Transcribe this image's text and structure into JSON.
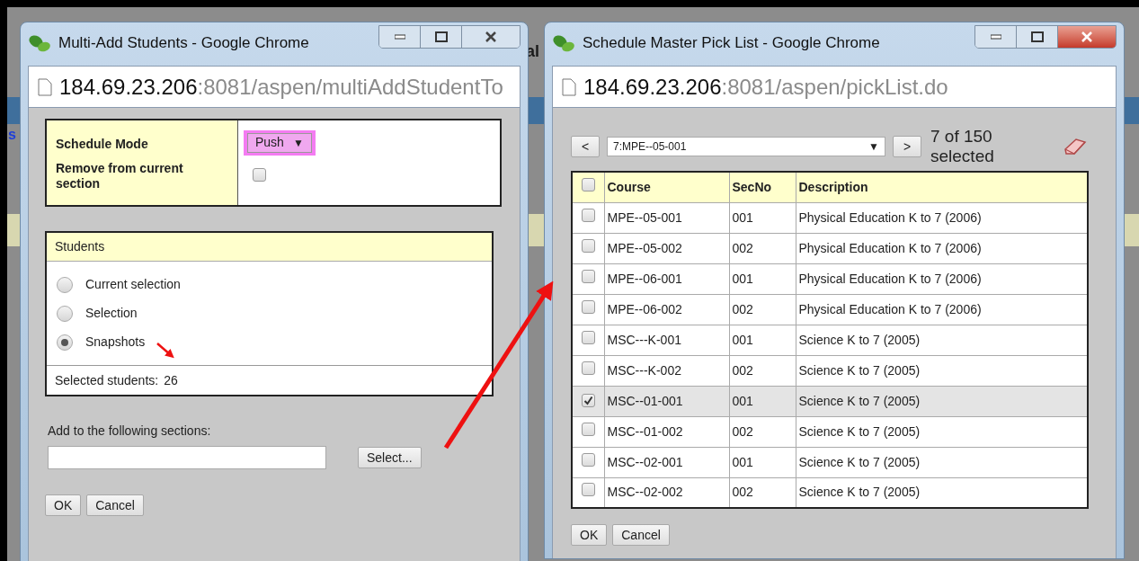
{
  "background": {
    "fragments": [
      {
        "text": "s"
      },
      {
        "text": "al"
      }
    ]
  },
  "multi_add_window": {
    "title": "Multi-Add Students - Google Chrome",
    "active": false,
    "url_host": "184.69.23.206",
    "url_path": ":8081/aspen/multiAddStudentTo",
    "schedule_mode": {
      "label": "Schedule Mode",
      "value": "Push",
      "arrow": "▼"
    },
    "remove_from_current": {
      "label": "Remove from current section",
      "checked": false
    },
    "students": {
      "heading": "Students",
      "options": [
        {
          "label": "Current selection",
          "selected": false
        },
        {
          "label": "Selection",
          "selected": false
        },
        {
          "label": "Snapshots",
          "selected": true
        }
      ],
      "selected_label": "Selected students:",
      "selected_count": "26"
    },
    "sections": {
      "label": "Add to the following sections:",
      "select_button": "Select..."
    },
    "buttons": [
      "OK",
      "Cancel"
    ]
  },
  "pick_list_window": {
    "title": "Schedule Master Pick List - Google Chrome",
    "active": true,
    "url_host": "184.69.23.206",
    "url_path": ":8081/aspen/pickList.do",
    "prev": "<",
    "next": ">",
    "dropdown": {
      "value": "7:MPE--05-001",
      "arrow": "▼"
    },
    "count": "7 of 150 selected",
    "table": {
      "header_checked": false,
      "columns": [
        "Course",
        "SecNo",
        "Description"
      ],
      "rows": [
        {
          "cells": [
            "MPE--05-001",
            "001",
            "Physical Education K to 7 (2006)"
          ],
          "checked": false
        },
        {
          "cells": [
            "MPE--05-002",
            "002",
            "Physical Education K to 7 (2006)"
          ],
          "checked": false
        },
        {
          "cells": [
            "MPE--06-001",
            "001",
            "Physical Education K to 7 (2006)"
          ],
          "checked": false
        },
        {
          "cells": [
            "MPE--06-002",
            "002",
            "Physical Education K to 7 (2006)"
          ],
          "checked": false
        },
        {
          "cells": [
            "MSC---K-001",
            "001",
            "Science K to 7 (2005)"
          ],
          "checked": false
        },
        {
          "cells": [
            "MSC---K-002",
            "002",
            "Science K to 7 (2005)"
          ],
          "checked": false
        },
        {
          "cells": [
            "MSC--01-001",
            "001",
            "Science K to 7 (2005)"
          ],
          "checked": true
        },
        {
          "cells": [
            "MSC--01-002",
            "002",
            "Science K to 7 (2005)"
          ],
          "checked": false
        },
        {
          "cells": [
            "MSC--02-001",
            "001",
            "Science K to 7 (2005)"
          ],
          "checked": false
        },
        {
          "cells": [
            "MSC--02-002",
            "002",
            "Science K to 7 (2005)"
          ],
          "checked": false
        }
      ]
    },
    "buttons": [
      "OK",
      "Cancel"
    ]
  }
}
